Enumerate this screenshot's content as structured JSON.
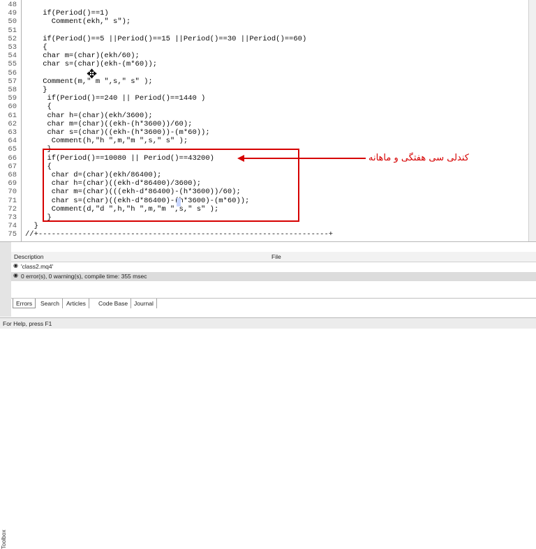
{
  "editor": {
    "line_numbers": [
      "48",
      "49",
      "50",
      "51",
      "52",
      "53",
      "54",
      "55",
      "56",
      "57",
      "58",
      "59",
      "60",
      "61",
      "62",
      "63",
      "64",
      "65",
      "66",
      "67",
      "68",
      "69",
      "70",
      "71",
      "72",
      "73",
      "74",
      "75"
    ],
    "lines": [
      "",
      "    if(Period()==1)",
      "      Comment(ekh,\" s\");",
      "",
      "    if(Period()==5 ||Period()==15 ||Period()==30 ||Period()==60)",
      "    {",
      "    char m=(char)(ekh/60);",
      "    char s=(char)(ekh-(m*60));",
      "",
      "    Comment(m,\" m \",s,\" s\" );",
      "    }",
      "     if(Period()==240 || Period()==1440 )",
      "     {",
      "     char h=(char)(ekh/3600);",
      "     char m=(char)((ekh-(h*3600))/60);",
      "     char s=(char)((ekh-(h*3600))-(m*60));",
      "      Comment(h,\"h \",m,\"m \",s,\" s\" );",
      "     }",
      "     if(Period()==10080 || Period()==43200)",
      "     {",
      "      char d=(char)(ekh/86400);",
      "      char h=(char)((ekh-d*86400)/3600);",
      "      char m=(char)(((ekh-d*86400)-(h*3600))/60);",
      "      char s=(char)((ekh-d*86400)-(h*3600)-(m*60));",
      "      Comment(d,\"d \",h,\"h \",m,\"m \",s,\" s\" );",
      "     }",
      "  }",
      "//+------------------------------------------------------------------+"
    ],
    "annotation": "کندلی سی هفتگی و ماهانه"
  },
  "toolbox": {
    "label": "Toolbox"
  },
  "panel": {
    "columns": {
      "description": "Description",
      "file": "File"
    },
    "rows": [
      {
        "icon": "info-icon",
        "text": "'class2.mq4'"
      },
      {
        "icon": "info-icon",
        "text": "0 error(s), 0 warning(s), compile time: 355 msec"
      }
    ],
    "tabs": [
      "Errors",
      "Search",
      "Articles",
      "Code Base",
      "Journal"
    ]
  },
  "status": {
    "text": "For Help, press F1"
  },
  "colors": {
    "annotation": "#d60000",
    "keyword": "#1c2fa8"
  }
}
